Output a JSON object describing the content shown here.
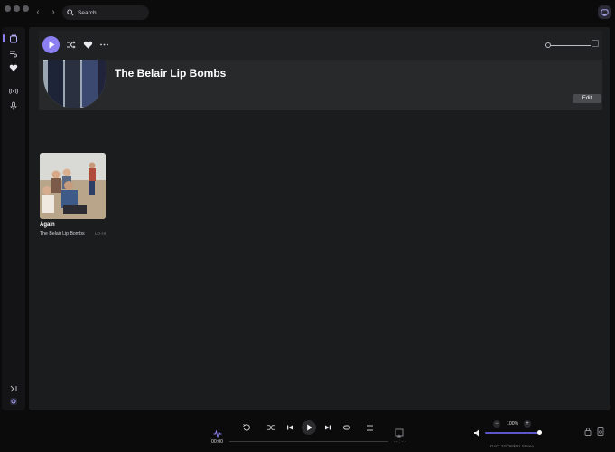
{
  "search": {
    "label": "Search"
  },
  "artist": {
    "name": "The Belair Lip Bombs",
    "edit_label": "Edit"
  },
  "albums": [
    {
      "title": "Again",
      "artist": "The Belair Lip Bombs",
      "badge": "LO·HI"
    }
  ],
  "player": {
    "current_time": "00:00",
    "end_time": "- - : - -",
    "volume": "100%",
    "volume_minus": "−",
    "volume_plus": "+",
    "dac": "DAC: 32/768kHz Stereo",
    "progress": 0,
    "volume_level": 1.0
  },
  "colors": {
    "accent": "#8b7ff2",
    "background": "#1b1c1e",
    "volume": "#5d57c9"
  },
  "icons": {
    "sidebar": [
      "library-icon",
      "playlist-icon",
      "heart-icon",
      "radio-icon",
      "microphone-icon",
      "expand-icon",
      "settings-icon"
    ],
    "toolbar": [
      "play-icon",
      "shuffle-icon",
      "heart-icon",
      "more-icon"
    ]
  }
}
